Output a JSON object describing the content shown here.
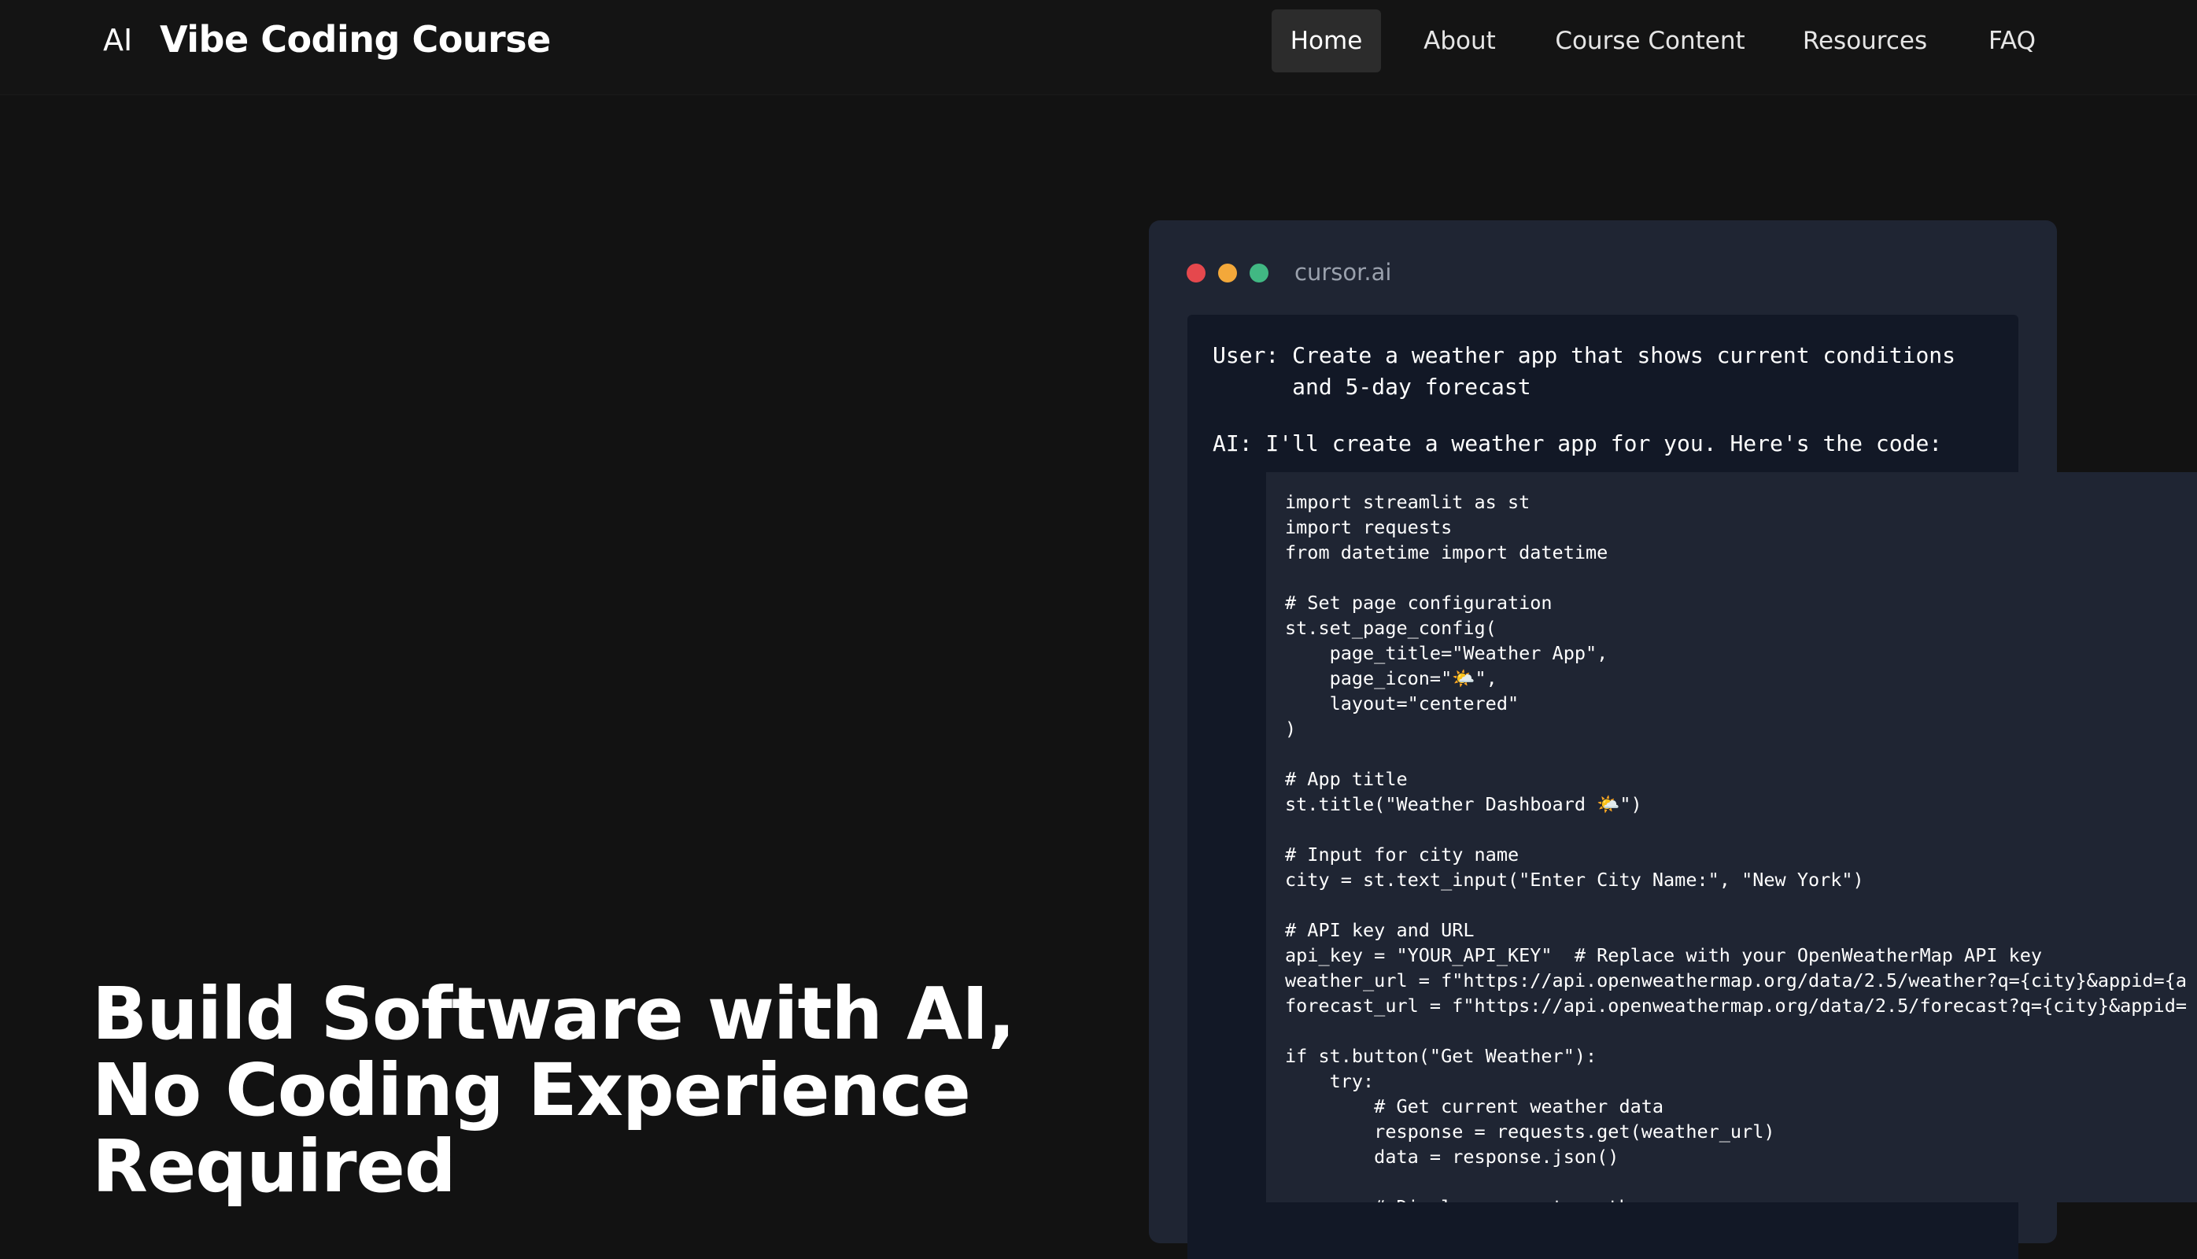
{
  "header": {
    "logo_mark": "AI",
    "logo_text": "Vibe Coding Course",
    "nav": [
      {
        "label": "Home",
        "active": true
      },
      {
        "label": "About",
        "active": false
      },
      {
        "label": "Course Content",
        "active": false
      },
      {
        "label": "Resources",
        "active": false
      },
      {
        "label": "FAQ",
        "active": false
      }
    ]
  },
  "hero": {
    "title_lines": [
      "Build Software with AI,",
      "No Coding Experience",
      "Required"
    ]
  },
  "editor": {
    "window_title": "cursor.ai",
    "chat": {
      "user_line1": "User: Create a weather app that shows current conditions",
      "user_line2": "      and 5-day forecast",
      "ai_line": "AI: I'll create a weather app for you. Here's the code:"
    },
    "code_lines": [
      "import streamlit as st",
      "import requests",
      "from datetime import datetime",
      "",
      "# Set page configuration",
      "st.set_page_config(",
      "    page_title=\"Weather App\",",
      "    page_icon=\"🌤️\",",
      "    layout=\"centered\"",
      ")",
      "",
      "# App title",
      "st.title(\"Weather Dashboard 🌤️\")",
      "",
      "# Input for city name",
      "city = st.text_input(\"Enter City Name:\", \"New York\")",
      "",
      "# API key and URL",
      "api_key = \"YOUR_API_KEY\"  # Replace with your OpenWeatherMap API key",
      "weather_url = f\"https://api.openweathermap.org/data/2.5/weather?q={city}&appid={a",
      "forecast_url = f\"https://api.openweathermap.org/data/2.5/forecast?q={city}&appid=",
      "",
      "if st.button(\"Get Weather\"):",
      "    try:",
      "        # Get current weather data",
      "        response = requests.get(weather_url)",
      "        data = response.json()",
      "",
      "        # Display current weather"
    ]
  },
  "colors": {
    "page_bg": "#121212",
    "window_bg": "#1f2533",
    "chat_bg": "#121826",
    "dot_red": "#e5484d",
    "dot_yellow": "#f3a83a",
    "dot_green": "#41b883"
  }
}
